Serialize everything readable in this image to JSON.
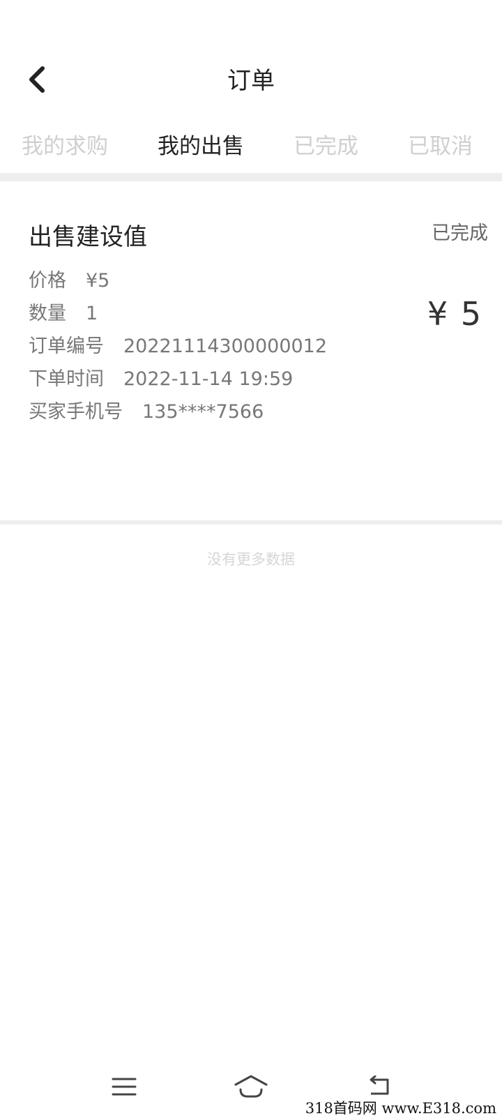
{
  "header": {
    "title": "订单",
    "back_icon": "chevron-left-icon"
  },
  "tabs": [
    {
      "label": "我的求购",
      "active": false
    },
    {
      "label": "我的出售",
      "active": true
    },
    {
      "label": "已完成",
      "active": false
    },
    {
      "label": "已取消",
      "active": false
    }
  ],
  "order": {
    "title": "出售建设值",
    "status": "已完成",
    "total": "¥ 5",
    "fields": [
      {
        "label": "价格",
        "value": "¥5"
      },
      {
        "label": "数量",
        "value": "1"
      },
      {
        "label": "订单编号",
        "value": "20221114300000012"
      },
      {
        "label": "下单时间",
        "value": "2022-11-14  19:59"
      },
      {
        "label": "买家手机号",
        "value": "135****7566"
      }
    ]
  },
  "list_end_text": "没有更多数据",
  "system_nav": {
    "menu_icon": "menu-icon",
    "home_icon": "home-icon",
    "back_icon": "back-arrow-icon"
  },
  "watermark": "318首码网 www.E318.com",
  "colors": {
    "active_tab": "#222222",
    "inactive_tab": "#cfcfcf",
    "divider": "#eeeeee"
  }
}
